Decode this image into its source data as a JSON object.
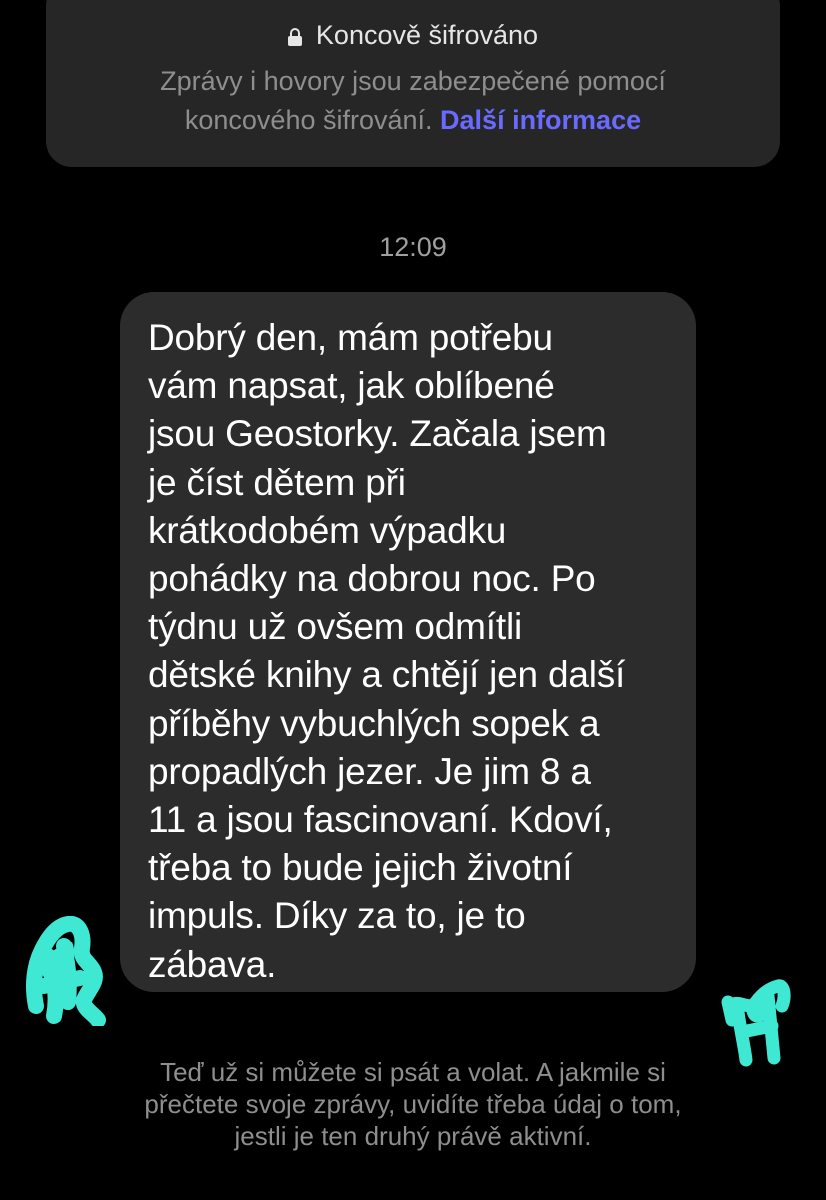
{
  "encryption_notice": {
    "title": "Koncově šifrováno",
    "description": "Zprávy i hovory jsou zabezpečené pomocí koncového šifrování.",
    "link_label": "Další informace",
    "lock_icon": "lock-icon",
    "link_color": "#6a6aff"
  },
  "conversation": {
    "timestamp": "12:09",
    "messages": [
      {
        "direction": "incoming",
        "text": "Dobrý den, mám potřebu\nvám napsat, jak oblíbené\njsou Geostorky. Začala jsem\nje číst dětem při\nkrátkodobém výpadku\npohádky na dobrou noc. Po\ntýdnu už ovšem odmítli\ndětské knihy a chtějí jen další\npříběhy vybuchlých sopek a\npropadlých jezer. Je jim 8 a\n11 a jsou fascinovaní. Kdoví,\ntřeba to bude jejich životní\nimpuls. Díky za to, je to\nzábava."
      }
    ]
  },
  "footer_note": "Teď už si můžete si psát a volat. A jakmile si přečtete svoje zprávy, uvidíte třeba údaj o tom, jestli je ten druhý právě aktivní.",
  "redaction_color": "#3fe8d2"
}
